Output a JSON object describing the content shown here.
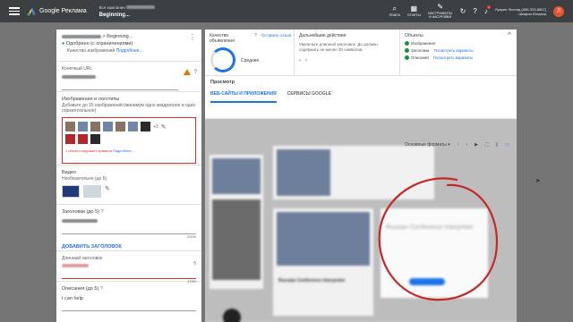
{
  "topbar": {
    "logo_text": "Google Реклама",
    "campaign_line1": "Все кампании",
    "campaign_line2": "Beginning...",
    "tools": [
      {
        "icon": "search-icon",
        "label": "ПОИСК"
      },
      {
        "icon": "chart-icon",
        "label": "ОТЧЕТЫ"
      },
      {
        "icon": "wrench-icon",
        "label": "ИНСТРУМЕНТЫ И НАСТРОЙКИ"
      }
    ],
    "account_line1": "Луарин Леонид (596-333-8867)",
    "account_line2": "Шкарин Юлиана",
    "notification_count": "1",
    "avatar_letter": "Л"
  },
  "left": {
    "ad_name_suffix": "> Beginning...",
    "status": "Одобрено (с ограничениями)",
    "status_detail": "Качество изображений",
    "status_link": "Подробнее...",
    "final_url_label": "Конечный URL",
    "images_title": "Изображения и логотипы",
    "images_desc": "Добавьте до 15 изображений (минимум одно квадратное и одно горизонтальное)",
    "images_more": "+3",
    "images_error": "1 объект нарушает правила",
    "images_error_link": "Подробнее...",
    "video_title": "Видео",
    "video_desc": "Необязательно (до 5)",
    "headlines_title": "Заголовки (до 5)",
    "headlines_counter": "20/30",
    "add_headline": "ДОБАВИТЬ ЗАГОЛОВОК",
    "long_headline_label": "Длинный заголовок",
    "long_headline_counter": "17/90",
    "descriptions_title": "Описания (до 5)",
    "description_value": "I can help"
  },
  "stats": {
    "quality_title": "Качество объявления",
    "quality_link": "Оставить отзыв",
    "quality_value": "Среднее",
    "quality_ratio": 0.75,
    "next_title": "Дальнейшие действия",
    "next_text": "Увеличьте длинный заголовок. До должен содержать не менее 30 символов.",
    "objects_title": "Объекты",
    "objects": [
      {
        "label": "Изображения",
        "link": ""
      },
      {
        "label": "Заголовки",
        "link": "Посмотреть варианты"
      },
      {
        "label": "Описания",
        "link": "Посмотреть варианты"
      }
    ]
  },
  "preview": {
    "title": "Просмотр",
    "tabs": [
      "ВЕБ-САЙТЫ И ПРИЛОЖЕНИЯ",
      "СЕРВИСЫ GOOGLE"
    ],
    "format_select": "Основные форматы",
    "card_headline": "Russian Conference Interpreter"
  }
}
